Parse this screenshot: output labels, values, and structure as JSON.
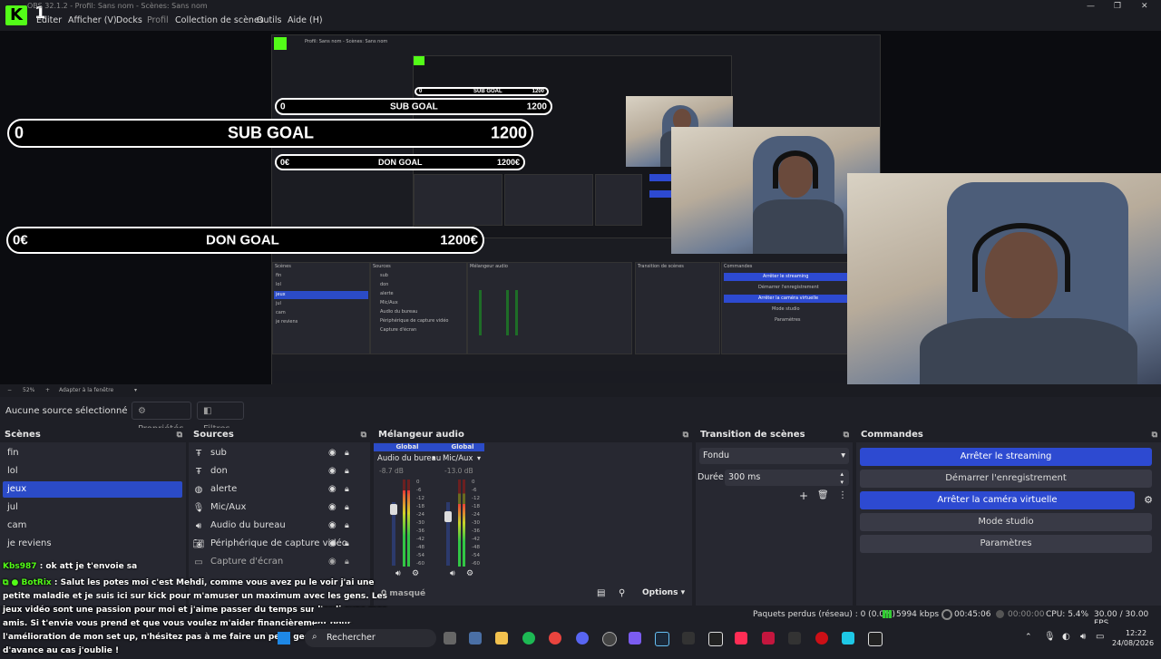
{
  "window": {
    "title": "OBS 32.1.2 - Profil: Sans nom - Scènes: Sans nom",
    "logo_text": "K",
    "logo_number": "1"
  },
  "menu": [
    "Éditer",
    "Afficher (V)",
    "Docks",
    "Profil",
    "Collection de scènes",
    "Outils",
    "Aide (H)"
  ],
  "goals": {
    "sub": {
      "start": "0",
      "label": "SUB GOAL",
      "target": "1200"
    },
    "don": {
      "start": "0€",
      "label": "DON GOAL",
      "target": "1200€"
    }
  },
  "nested_preview": {
    "title": "Profil: Sans nom - Scènes: Sans nom",
    "scenes": [
      "fin",
      "lol",
      "jeux",
      "jul",
      "cam",
      "je reviens"
    ],
    "sources": [
      "sub",
      "don",
      "alerte",
      "Mic/Aux",
      "Audio du bureau",
      "Périphérique de capture vidéo",
      "Capture d'écran"
    ],
    "commands": [
      "Arrêter le streaming",
      "Démarrer l'enregistrement",
      "Arrêter la caméra virtuelle",
      "Mode studio",
      "Paramètres"
    ]
  },
  "zoombar": {
    "zoom": "52%",
    "fit": "Adapter à la fenêtre"
  },
  "source_bar": {
    "status": "Aucune source sélectionné",
    "properties": "Propriétés",
    "filters": "Filtres"
  },
  "scenes": {
    "title": "Scènes",
    "items": [
      "fin",
      "lol",
      "jeux",
      "jul",
      "cam",
      "je reviens"
    ],
    "selected": "jeux"
  },
  "sources": {
    "title": "Sources",
    "items": [
      {
        "label": "sub",
        "icon": "text-icon"
      },
      {
        "label": "don",
        "icon": "text-icon"
      },
      {
        "label": "alerte",
        "icon": "browser-icon"
      },
      {
        "label": "Mic/Aux",
        "icon": "mic-icon"
      },
      {
        "label": "Audio du bureau",
        "icon": "speaker-icon"
      },
      {
        "label": "Périphérique de capture vidéo",
        "icon": "camera-icon"
      },
      {
        "label": "Capture d'écran",
        "icon": "monitor-icon"
      }
    ]
  },
  "mixer": {
    "title": "Mélangeur audio",
    "channels": [
      {
        "name": "Global",
        "device": "Audio du bureau",
        "db": "-8.7 dB",
        "level": 0.12
      },
      {
        "name": "Global",
        "device": "Mic/Aux",
        "db": "-13.0 dB",
        "level": 0.28
      }
    ],
    "scale": [
      "0",
      "-6",
      "-12",
      "-18",
      "-24",
      "-30",
      "-36",
      "-42",
      "-48",
      "-54",
      "-60"
    ],
    "masked": "0 masqué",
    "options": "Options"
  },
  "transition": {
    "title": "Transition de scènes",
    "type": "Fondu",
    "duration_label": "Durée",
    "duration": "300 ms"
  },
  "commands": {
    "title": "Commandes",
    "buttons": [
      {
        "label": "Arrêter le streaming",
        "active": true
      },
      {
        "label": "Démarrer l'enregistrement",
        "active": false
      },
      {
        "label": "Arrêter la caméra virtuelle",
        "active": true
      },
      {
        "label": "Mode studio",
        "active": false
      },
      {
        "label": "Paramètres",
        "active": false
      }
    ]
  },
  "status": {
    "dropped": "Paquets perdus (réseau) : 0 (0.0%)",
    "bitrate": "5994 kbps",
    "stream_time": "00:45:06",
    "rec_time": "00:00:00",
    "cpu": "CPU: 5.4%",
    "fps": "30.00 / 30.00 FPS"
  },
  "chat": [
    {
      "user": "Kbs987",
      "text": " : ok att je t'envoie sa",
      "color": "#53fc18"
    },
    {
      "user": "BotRix",
      "text": " : Salut les potes moi c'est Mehdi, comme vous avez pu le voir j'ai une",
      "color": "#53fc18"
    },
    {
      "user": "",
      "text": "petite maladie et je suis ici sur kick pour m'amuser un maximum avec les gens. Les",
      "color": "#ffffff"
    },
    {
      "user": "",
      "text": "jeux vidéo sont une passion pour moi et j'aime passer du temps sur l'ordi avec mes",
      "color": "#ffffff"
    },
    {
      "user": "",
      "text": "amis. Si t'envie vous prend et que vous voulez m'aider financièrement pour",
      "color": "#ffffff"
    },
    {
      "user": "",
      "text": "l'amélioration de mon set up, n'hésitez pas à me faire un petit geste et merci",
      "color": "#ffffff"
    },
    {
      "user": "",
      "text": "d'avance au cas j'oublie !",
      "color": "#ffffff"
    }
  ],
  "taskbar": {
    "search": "Rechercher",
    "time": "12:22",
    "date": "24/08/2026"
  },
  "colors": {
    "accent": "#2b4bc7",
    "kick": "#53fc18",
    "panel": "#272831"
  }
}
